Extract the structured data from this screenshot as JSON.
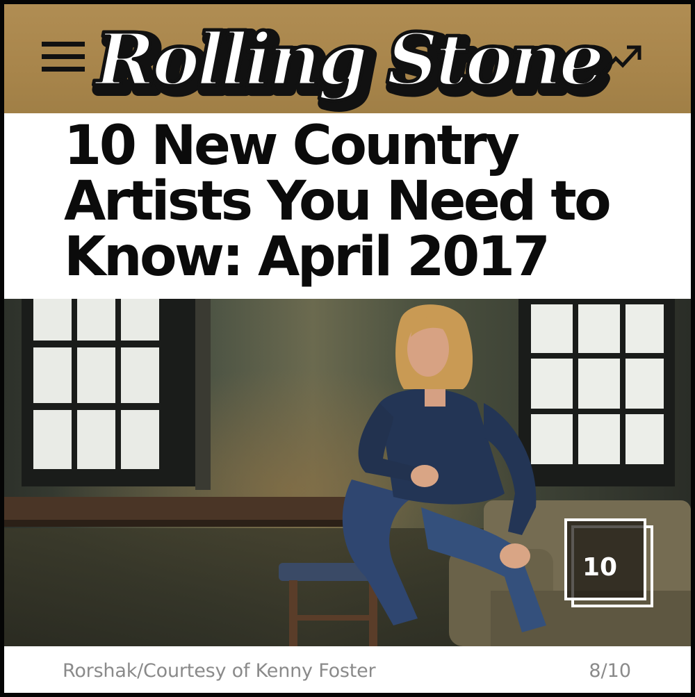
{
  "header": {
    "logo_text": "Rolling Stone",
    "menu_icon": "hamburger-menu-icon",
    "trending_icon": "trending-arrow-icon",
    "background_color": "#a8854b"
  },
  "article": {
    "headline": "10 New Country Artists You Need to Know: April 2017"
  },
  "gallery": {
    "count_badge": "10",
    "photo_description_icon": "photo",
    "credit": "Rorshak/Courtesy of Kenny Foster",
    "position": "8/10"
  }
}
